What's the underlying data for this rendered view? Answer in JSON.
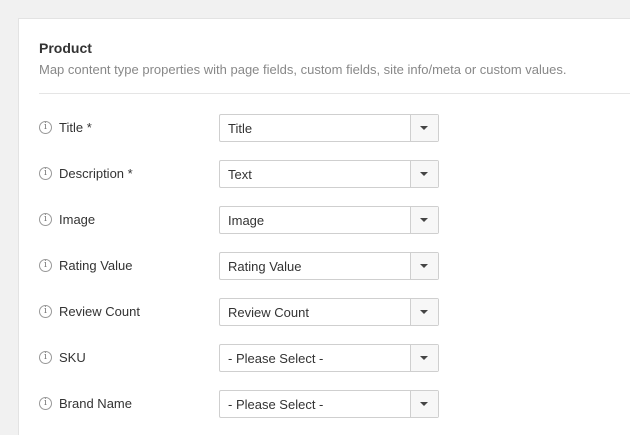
{
  "section": {
    "title": "Product",
    "description": "Map content type properties with page fields, custom fields, site info/meta or custom values."
  },
  "icons": {
    "info": "info-icon",
    "dropdown": "caret-down-icon",
    "info_glyph": "i"
  },
  "fields": [
    {
      "label": "Title *",
      "value": "Title"
    },
    {
      "label": "Description *",
      "value": "Text"
    },
    {
      "label": "Image",
      "value": "Image"
    },
    {
      "label": "Rating Value",
      "value": "Rating Value"
    },
    {
      "label": "Review Count",
      "value": "Review Count"
    },
    {
      "label": "SKU",
      "value": "- Please Select -"
    },
    {
      "label": "Brand Name",
      "value": "- Please Select -"
    }
  ]
}
